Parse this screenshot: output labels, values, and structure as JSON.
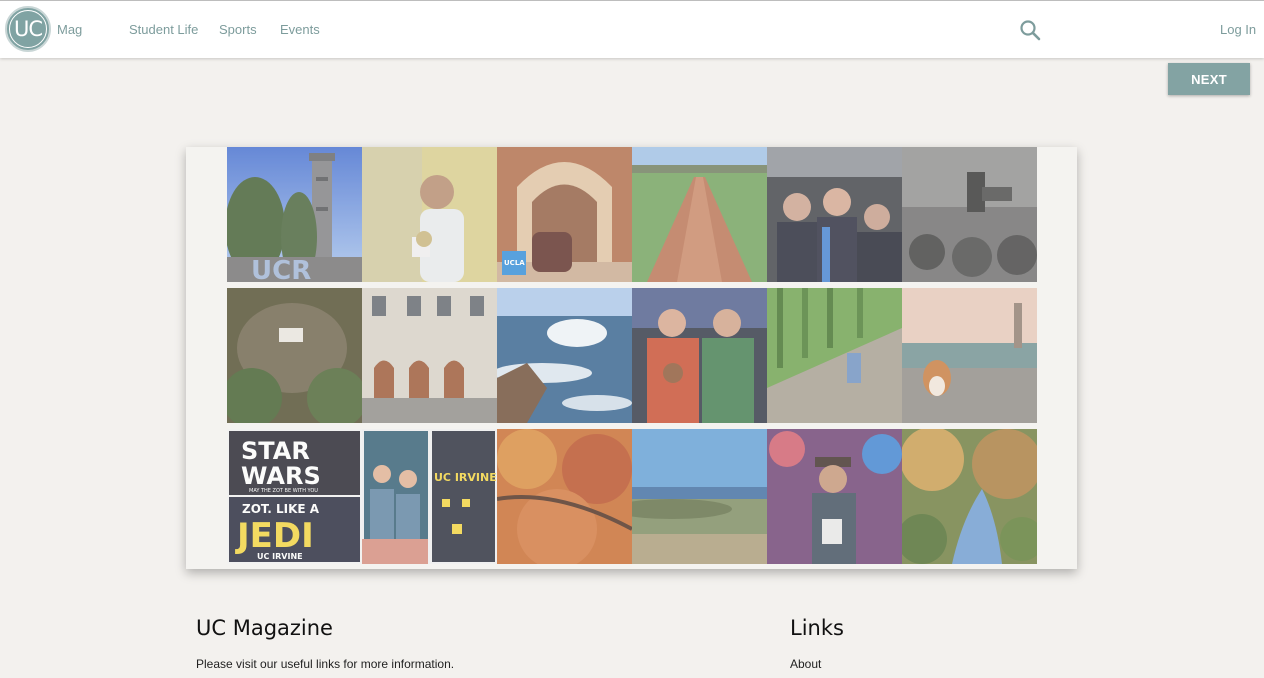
{
  "header": {
    "logo_text": "UC",
    "brand_label": "Mag",
    "nav": [
      "Student Life",
      "Sports",
      "Events"
    ],
    "login_label": "Log In"
  },
  "gallery": {
    "next_label": "NEXT",
    "tiles": [
      "tower-UCR",
      "glass-speaker",
      "arches-plush",
      "campus-walk",
      "graduation",
      "church-bw",
      "forest-rock",
      "building-facade",
      "ocean-waves",
      "holiday-sweaters",
      "bamboo-bench",
      "corgi-tower",
      "star-wars-jedi",
      "vintage-sweaters",
      "autumn-leaves",
      "coast-view",
      "performer",
      "river-trees"
    ],
    "tile_captions": {
      "tower": "UCR",
      "ucla_badge": "UCLA",
      "starwars_1": "STAR",
      "starwars_2": "WARS",
      "starwars_3": "MAY THE ZOT BE WITH YOU",
      "starwars_4": "ZOT. LIKE A",
      "starwars_5": "JEDI",
      "starwars_6": "UC IRVINE",
      "sweater": "UC IRVINE"
    }
  },
  "footer": {
    "col1_title": "UC Magazine",
    "col1_text": "Please visit our useful links for more information.",
    "col2_title": "Links",
    "col2_link": "About"
  },
  "colors": {
    "accent": "#80a3a3",
    "background": "#f3f1ee"
  }
}
